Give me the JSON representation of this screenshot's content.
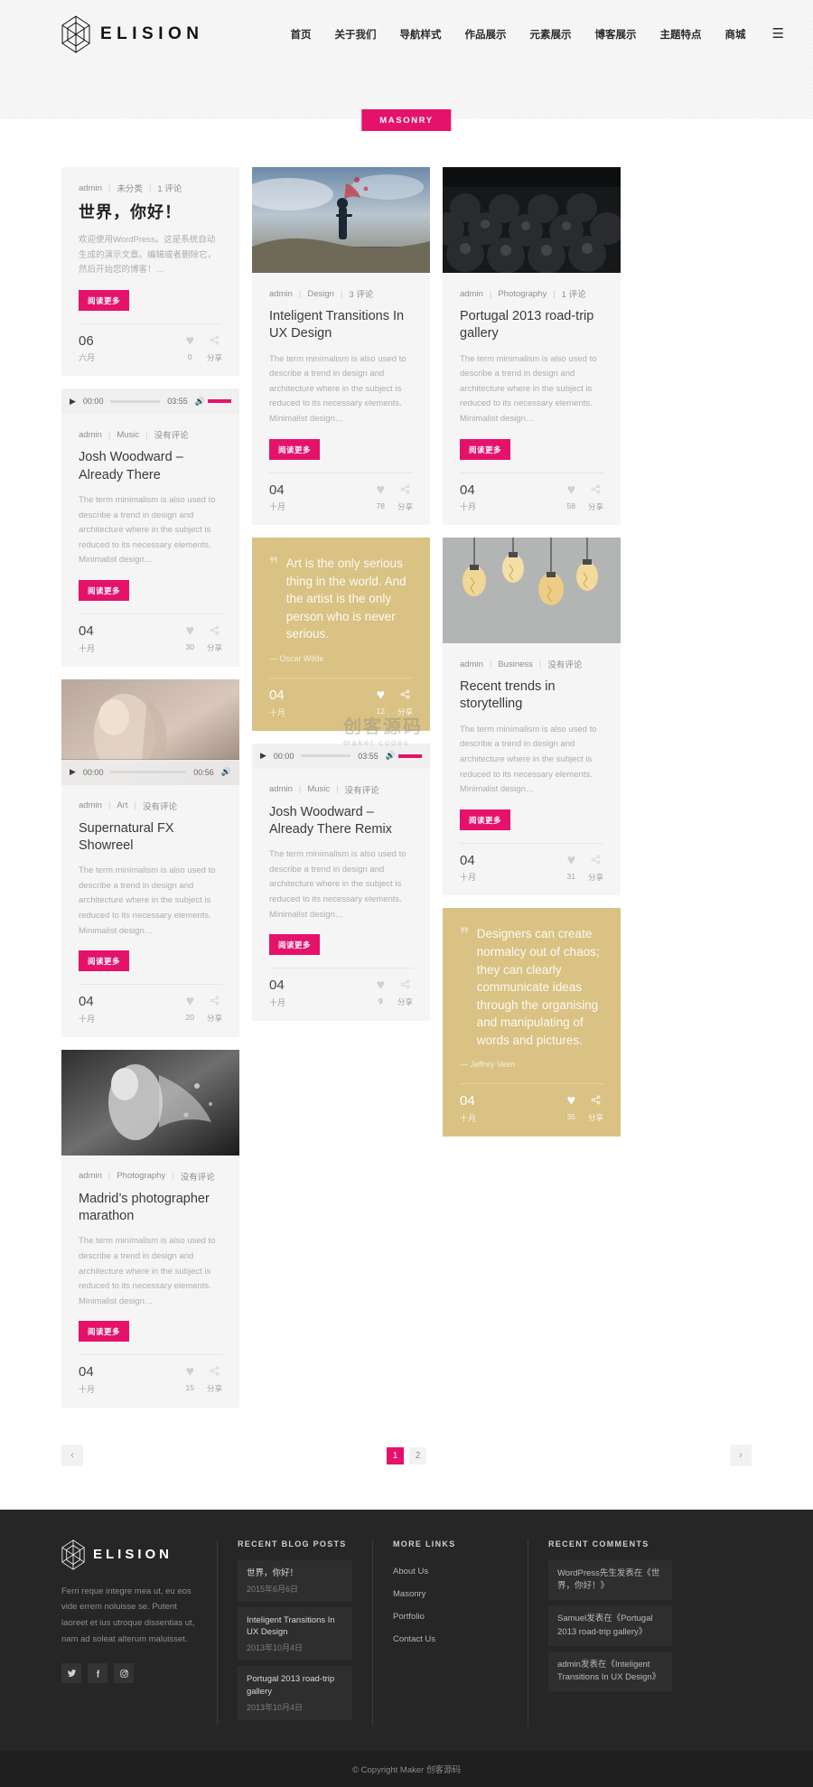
{
  "header": {
    "brand": "ELISION",
    "nav": [
      {
        "label": "首页"
      },
      {
        "label": "关于我们"
      },
      {
        "label": "导航样式"
      },
      {
        "label": "作品展示"
      },
      {
        "label": "元素展示"
      },
      {
        "label": "博客展示"
      },
      {
        "label": "主题特点"
      },
      {
        "label": "商城"
      }
    ],
    "burger": "☰"
  },
  "page_title": "MASONRY",
  "labels": {
    "read_more": "阅读更多",
    "share": "分享",
    "heart": "♥",
    "share_icon": "share-icon",
    "sep": "|"
  },
  "posts": [
    {
      "id": "hello-world",
      "author": "admin",
      "category": "未分类",
      "comments": "1 评论",
      "title": "世界，你好！",
      "cjk": true,
      "excerpt": "欢迎使用WordPress。这是系统自动生成的演示文章。编辑或者删除它，然后开始您的博客！…",
      "day": "06",
      "month": "六月",
      "likes": "0"
    },
    {
      "id": "josh-woodward-already-there",
      "author": "admin",
      "category": "Music",
      "comments": "没有评论",
      "title": "Josh Woodward – Already There",
      "excerpt": "The term minimalism is also used to describe a trend in design and architecture where in the subject is reduced to its necessary elements. Minimalist design…",
      "day": "04",
      "month": "十月",
      "likes": "30",
      "audio": {
        "current": "00:00",
        "duration": "03:55"
      }
    },
    {
      "id": "supernatural-fx-showreel",
      "author": "admin",
      "category": "Art",
      "comments": "没有评论",
      "title": "Supernatural FX Showreel",
      "excerpt": "The term minimalism is also used to describe a trend in design and architecture where in the subject is reduced to its necessary elements. Minimalist design…",
      "day": "04",
      "month": "十月",
      "likes": "20",
      "video": {
        "current": "00:00",
        "duration": "00:56"
      }
    },
    {
      "id": "madrids-photographer-marathon",
      "author": "admin",
      "category": "Photography",
      "comments": "没有评论",
      "title": "Madrid’s photographer marathon",
      "excerpt": "The term minimalism is also used to describe a trend in design and architecture where in the subject is reduced to its necessary elements. Minimalist design…",
      "day": "04",
      "month": "十月",
      "likes": "15"
    },
    {
      "id": "inteligent-transitions",
      "author": "admin",
      "category": "Design",
      "comments": "3 评论",
      "title": "Inteligent Transitions In UX Design",
      "excerpt": "The term minimalism is also used to describe a trend in design and architecture where in the subject is reduced to its necessary elements. Minimalist design…",
      "day": "04",
      "month": "十月",
      "likes": "78"
    },
    {
      "id": "quote-oscar-wilde",
      "type": "quote",
      "quote": "Art is the only serious thing in the world. And the artist is the only person who is never serious.",
      "author_line": "— Oscar Wilde",
      "day": "04",
      "month": "十月",
      "likes": "12"
    },
    {
      "id": "josh-woodward-already-there-remix",
      "author": "admin",
      "category": "Music",
      "comments": "没有评论",
      "title": "Josh Woodward – Already There Remix",
      "excerpt": "The term minimalism is also used to describe a trend in design and architecture where in the subject is reduced to its necessary elements. Minimalist design…",
      "day": "04",
      "month": "十月",
      "likes": "9",
      "audio": {
        "current": "00:00",
        "duration": "03:55"
      }
    },
    {
      "id": "portugal-2013-road-trip-gallery",
      "author": "admin",
      "category": "Photography",
      "comments": "1 评论",
      "title": "Portugal 2013 road-trip gallery",
      "excerpt": "The term minimalism is also used to describe a trend in design and architecture where in the subject is reduced to its necessary elements. Minimalist design…",
      "day": "04",
      "month": "十月",
      "likes": "58"
    },
    {
      "id": "recent-trends-in-storytelling",
      "author": "admin",
      "category": "Business",
      "comments": "没有评论",
      "title": "Recent trends in storytelling",
      "excerpt": "The term minimalism is also used to describe a trend in design and architecture where in the subject is reduced to its necessary elements. Minimalist design…",
      "day": "04",
      "month": "十月",
      "likes": "31"
    },
    {
      "id": "quote-jeffrey-veen",
      "type": "quote",
      "quote": "Designers can create normalcy out of chaos; they can clearly communicate ideas through the organising and manipulating of words and pictures.",
      "author_line": "— Jeffrey Veen",
      "day": "04",
      "month": "十月",
      "likes": "35"
    }
  ],
  "pagination": {
    "prev": "‹",
    "next": "›",
    "pages": [
      "1",
      "2"
    ],
    "active": "1"
  },
  "footer": {
    "brand": "ELISION",
    "about": "Ferri reque integre mea ut, eu eos vide errem noluisse se. Putent laoreet et ius utroque dissentias ut, nam ad soleat alterum maluisset.",
    "social": [
      {
        "name": "twitter-icon",
        "glyph": "🐦"
      },
      {
        "name": "facebook-icon",
        "glyph": "f"
      },
      {
        "name": "instagram-icon",
        "glyph": "◙"
      }
    ],
    "recent_posts_title": "RECENT BLOG POSTS",
    "recent_posts": [
      {
        "title": "世界，你好！",
        "date": "2015年6月6日"
      },
      {
        "title": "Inteligent Transitions In UX Design",
        "date": "2013年10月4日"
      },
      {
        "title": "Portugal 2013 road-trip gallery",
        "date": "2013年10月4日"
      }
    ],
    "more_links_title": "MORE LINKS",
    "more_links": [
      "About Us",
      "Masonry",
      "Portfolio",
      "Contact Us"
    ],
    "recent_comments_title": "RECENT COMMENTS",
    "recent_comments": [
      "WordPress先生发表在《世界，你好！》",
      "Samuel发表在《Portugal 2013 road-trip gallery》",
      "admin发表在《Inteligent Transitions In UX Design》"
    ],
    "copyright": "© Copyright Maker 创客源码"
  },
  "watermark": {
    "main": "创客源码",
    "sub": "maker codes"
  },
  "colors": {
    "accent": "#e5126b",
    "quote_bg": "#d9c283",
    "footer_bg": "#262626",
    "card_bg": "#f5f5f5"
  }
}
